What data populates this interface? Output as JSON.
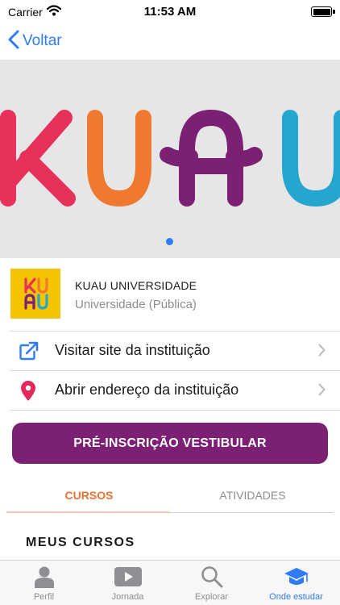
{
  "status_bar": {
    "carrier": "Carrier",
    "time": "11:53 AM"
  },
  "nav": {
    "back_label": "Voltar"
  },
  "banner": {
    "logo_text": "KUAU",
    "page_count": 1,
    "current_page": 1
  },
  "institution": {
    "logo_text": "KUAU",
    "name": "KUAU UNIVERSIDADE",
    "type": "Universidade (Pública)"
  },
  "links": {
    "website": "Visitar site da instituição",
    "address": "Abrir endereço da instituição"
  },
  "cta": {
    "label": "PRÉ-INSCRIÇÃO VESTIBULAR"
  },
  "tabs": [
    {
      "label": "CURSOS",
      "active": true
    },
    {
      "label": "ATIVIDADES",
      "active": false
    }
  ],
  "section": {
    "title": "MEUS CURSOS"
  },
  "tab_bar": [
    {
      "label": "Perfil",
      "icon": "person-icon"
    },
    {
      "label": "Jornada",
      "icon": "play-icon"
    },
    {
      "label": "Explorar",
      "icon": "search-icon"
    },
    {
      "label": "Onde estudar",
      "icon": "graduation-cap-icon",
      "selected": true
    }
  ],
  "colors": {
    "accent": "#2f7cf6",
    "brand_purple": "#7b2073",
    "tab_active": "#e77234",
    "logo_red": "#e8315a",
    "logo_orange": "#ef7a2f",
    "logo_purple": "#7b2073",
    "logo_blue": "#25a6cf",
    "logo_yellow": "#f5c400"
  }
}
